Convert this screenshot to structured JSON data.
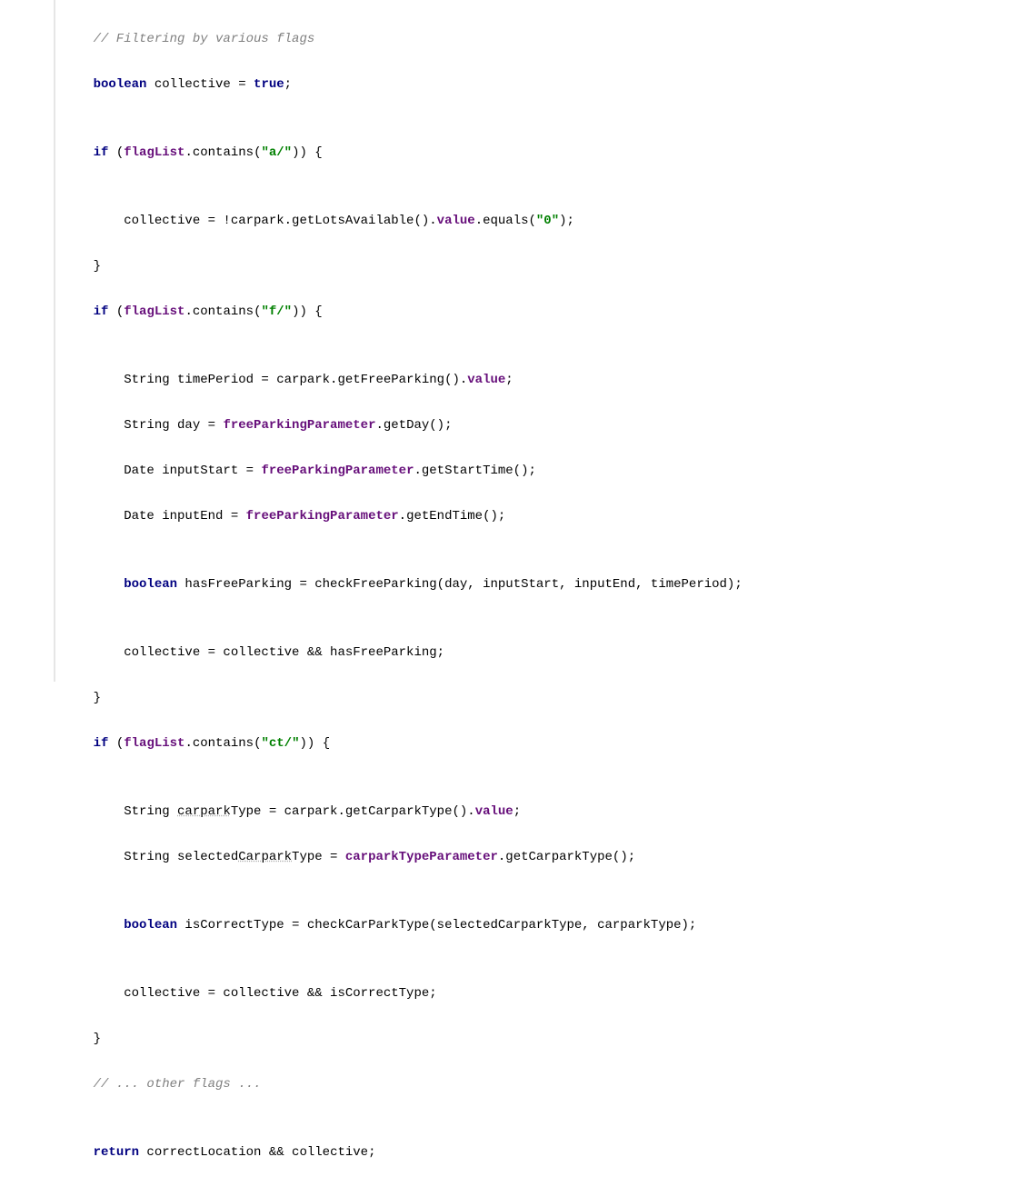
{
  "code": {
    "l1": "    // Filtering by various flags",
    "l2a": "    ",
    "l2b": "boolean",
    "l2c": " collective = ",
    "l2d": "true",
    "l2e": ";",
    "l3": "",
    "l4a": "    ",
    "l4b": "if",
    "l4c": " (",
    "l4d": "flagList",
    "l4e": ".contains(",
    "l4f": "\"a/\"",
    "l4g": ")) {",
    "l5": "",
    "l6a": "        collective = !carpark.getLotsAvailable().",
    "l6b": "value",
    "l6c": ".equals(",
    "l6d": "\"0\"",
    "l6e": ");",
    "l7": "    }",
    "l8a": "    ",
    "l8b": "if",
    "l8c": " (",
    "l8d": "flagList",
    "l8e": ".contains(",
    "l8f": "\"f/\"",
    "l8g": ")) {",
    "l9": "",
    "l10a": "        String timePeriod = carpark.getFreeParking().",
    "l10b": "value",
    "l10c": ";",
    "l11a": "        String day = ",
    "l11b": "freeParkingParameter",
    "l11c": ".getDay();",
    "l12a": "        Date inputStart = ",
    "l12b": "freeParkingParameter",
    "l12c": ".getStartTime();",
    "l13a": "        Date inputEnd = ",
    "l13b": "freeParkingParameter",
    "l13c": ".getEndTime();",
    "l14": "",
    "l15a": "        ",
    "l15b": "boolean",
    "l15c": " hasFreeParking = checkFreeParking(day, inputStart, inputEnd, timePeriod);",
    "l16": "",
    "l17": "        collective = collective && hasFreeParking;",
    "l18": "    }",
    "l19a": "    ",
    "l19b": "if",
    "l19c": " (",
    "l19d": "flagList",
    "l19e": ".contains(",
    "l19f": "\"ct/\"",
    "l19g": ")) {",
    "l20": "",
    "l21a": "        String ",
    "l21b": "carpark",
    "l21c": "Type = carpark.getCarparkType().",
    "l21d": "value",
    "l21e": ";",
    "l22a": "        String selected",
    "l22b": "Carpark",
    "l22c": "Type = ",
    "l22d": "carparkTypeParameter",
    "l22e": ".getCarparkType();",
    "l23": "",
    "l24a": "        ",
    "l24b": "boolean",
    "l24c": " isCorrectType = checkCarParkType(selectedCarparkType, carparkType);",
    "l25": "",
    "l26": "        collective = collective && isCorrectType;",
    "l27": "    }",
    "l28": "    // ... other flags ...",
    "l29": "",
    "l30a": "    ",
    "l30b": "return",
    "l30c": " correctLocation && collective;"
  }
}
